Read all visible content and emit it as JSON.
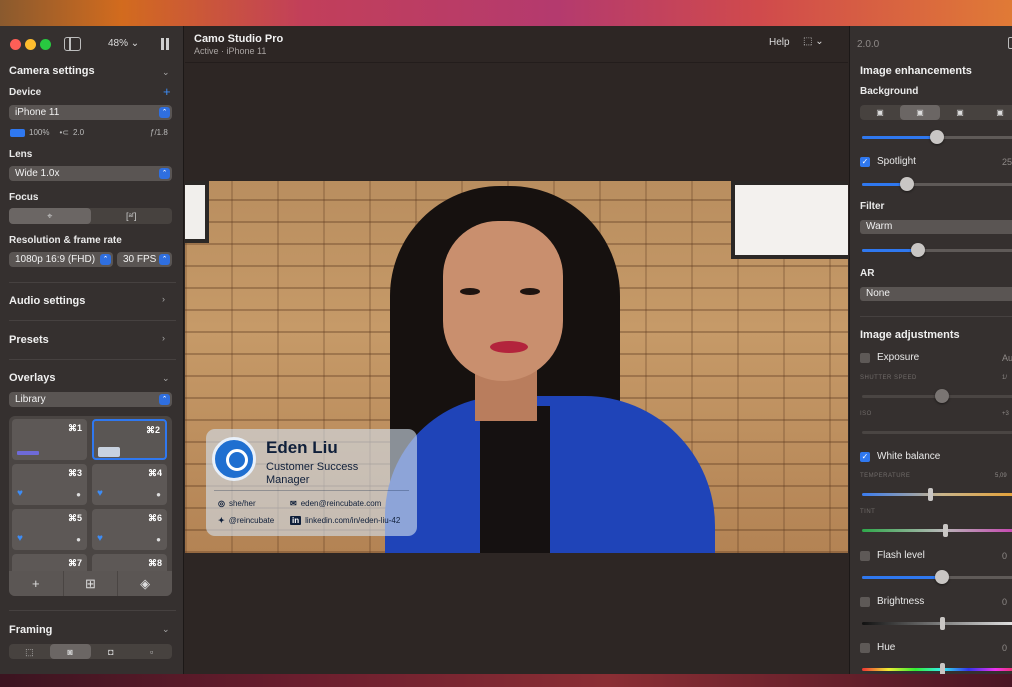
{
  "window": {
    "zoom": "48% ⌄",
    "app_title": "Camo Studio Pro",
    "app_status": "Active · iPhone 11",
    "help_label": "Help",
    "version": "2.0.0"
  },
  "camera_settings": {
    "title": "Camera settings",
    "device_label": "Device",
    "device_value": "iPhone 11",
    "battery": "100%",
    "usb": "2.0",
    "aperture": "ƒ/1.8",
    "lens_label": "Lens",
    "lens_value": "Wide 1.0x",
    "focus_label": "Focus",
    "resolution_label": "Resolution & frame rate",
    "resolution_value": "1080p 16:9 (FHD)",
    "fps_value": "30 FPS"
  },
  "sections": {
    "audio": "Audio settings",
    "presets": "Presets",
    "overlays": "Overlays",
    "overlays_source": "Library",
    "framing": "Framing"
  },
  "overlay_tiles": [
    {
      "key": "⌘1"
    },
    {
      "key": "⌘2"
    },
    {
      "key": "⌘3"
    },
    {
      "key": "⌘4"
    },
    {
      "key": "⌘5"
    },
    {
      "key": "⌘6"
    },
    {
      "key": "⌘7"
    },
    {
      "key": "⌘8"
    }
  ],
  "name_card": {
    "name": "Eden Liu",
    "role": "Customer Success Manager",
    "pronouns": "she/her",
    "email": "eden@reincubate.com",
    "twitter": "@reincubate",
    "linkedin": "linkedin.com/in/eden-liu-42"
  },
  "enhancements": {
    "title": "Image enhancements",
    "background_label": "Background",
    "background_slider": 0.47,
    "spotlight_label": "Spotlight",
    "spotlight_checked": true,
    "spotlight_value": "25",
    "spotlight_slider": 0.28,
    "filter_label": "Filter",
    "filter_value": "Warm",
    "filter_slider": 0.35,
    "ar_label": "AR",
    "ar_value": "None"
  },
  "adjustments": {
    "title": "Image adjustments",
    "exposure_label": "Exposure",
    "exposure_value": "Au",
    "shutter_caption": "SHUTTER SPEED",
    "shutter_value": "1/",
    "iso_caption": "ISO",
    "iso_value": "+3",
    "white_balance_label": "White balance",
    "white_balance_checked": true,
    "temperature_caption": "TEMPERATURE",
    "temperature_value": "5,09",
    "tint_caption": "TINT",
    "flash_label": "Flash level",
    "flash_value": "0",
    "brightness_label": "Brightness",
    "brightness_value": "0",
    "hue_label": "Hue",
    "hue_value": "0"
  },
  "colors": {
    "accent": "#2f78f0",
    "close": "#ff5f57",
    "minimize": "#febc2e",
    "maximize": "#28c840"
  },
  "icons": {
    "add_device": "plus-icon",
    "focus_modes": [
      "crosshair-icon",
      "auto-focus-icon"
    ],
    "overlay_toolbar": [
      "plus-icon",
      "grid-icon",
      "layers-icon"
    ]
  }
}
